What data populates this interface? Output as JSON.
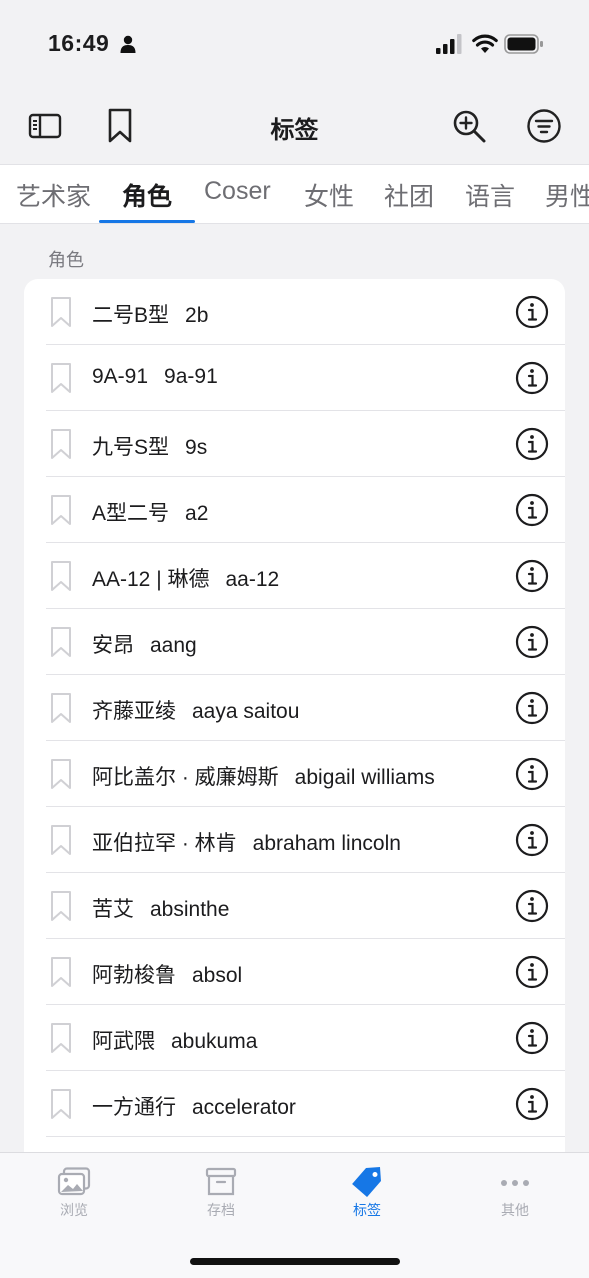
{
  "status_bar": {
    "time": "16:49"
  },
  "nav": {
    "title": "标签"
  },
  "tabs": [
    {
      "label": "艺术家"
    },
    {
      "label": "角色"
    },
    {
      "label": "Coser"
    },
    {
      "label": "女性"
    },
    {
      "label": "社团"
    },
    {
      "label": "语言"
    },
    {
      "label": "男性"
    }
  ],
  "active_tab": "角色",
  "section": {
    "title": "角色"
  },
  "tags": [
    {
      "zh": "二号B型",
      "en": "2b"
    },
    {
      "zh": "9A-91",
      "en": "9a-91"
    },
    {
      "zh": "九号S型",
      "en": "9s"
    },
    {
      "zh": "A型二号",
      "en": "a2"
    },
    {
      "zh": "AA-12 | 琳德",
      "en": "aa-12"
    },
    {
      "zh": "安昂",
      "en": "aang"
    },
    {
      "zh": "齐藤亚绫",
      "en": "aaya saitou"
    },
    {
      "zh": "阿比盖尔 · 威廉姆斯",
      "en": "abigail williams"
    },
    {
      "zh": "亚伯拉罕 · 林肯",
      "en": "abraham lincoln"
    },
    {
      "zh": "苦艾",
      "en": "absinthe"
    },
    {
      "zh": "阿勃梭鲁",
      "en": "absol"
    },
    {
      "zh": "阿武隈",
      "en": "abukuma"
    },
    {
      "zh": "一方通行",
      "en": "accelerator"
    }
  ],
  "tab_bar": {
    "items": [
      {
        "label": "浏览",
        "icon": "photo-icon"
      },
      {
        "label": "存档",
        "icon": "archive-box-icon"
      },
      {
        "label": "标签",
        "icon": "tag-icon"
      },
      {
        "label": "其他",
        "icon": "ellipsis-icon"
      }
    ],
    "active": "标签"
  },
  "colors": {
    "accent": "#1677e6",
    "inactive": "#a9abb3",
    "background": "#f2f2f4"
  }
}
